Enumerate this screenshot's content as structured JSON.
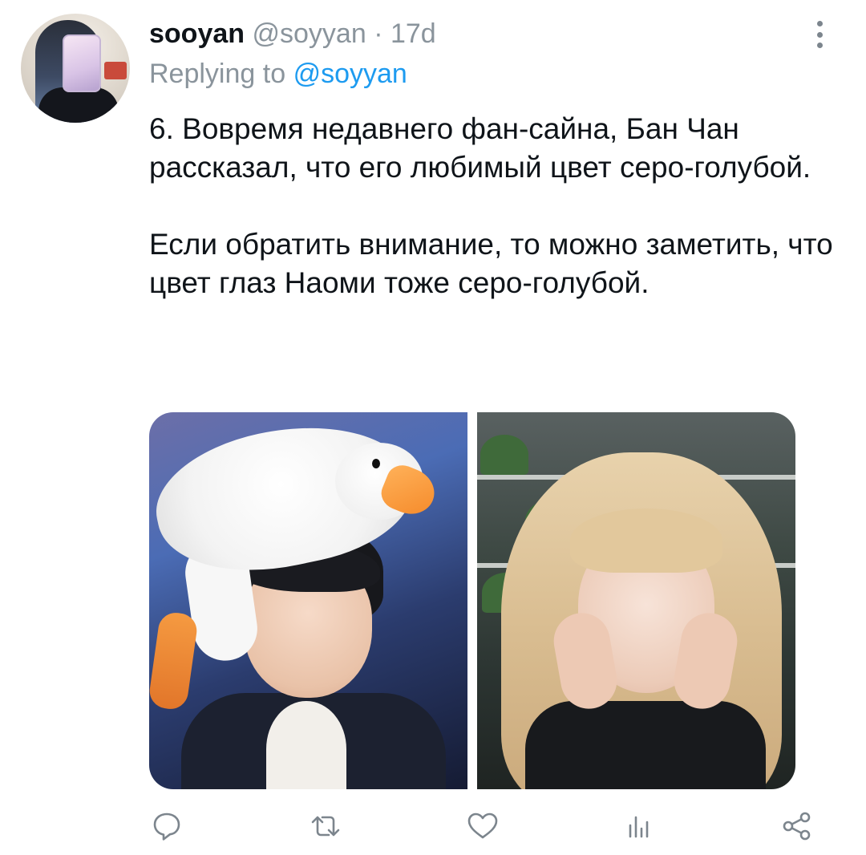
{
  "tweet": {
    "author": {
      "display_name": "sooyan",
      "handle": "@soyyan",
      "separator": "·",
      "age": "17d"
    },
    "reply": {
      "prefix": "Replying to",
      "mention": "@soyyan"
    },
    "paragraphs": [
      "6. Вовремя недавнего фан-сайна, Бан Чан рассказал, что его любимый цвет серо-голубой.",
      "Если обратить внимание, то можно заметить, что цвет глаз Наоми тоже серо-голубой."
    ]
  },
  "actions": {
    "icons": [
      "reply-icon",
      "retweet-icon",
      "like-icon",
      "analytics-icon",
      "share-icon"
    ]
  },
  "colors": {
    "text": "#0f1419",
    "secondary": "#8a949c",
    "accent": "#1d9bf0",
    "icon": "#7c858d"
  }
}
